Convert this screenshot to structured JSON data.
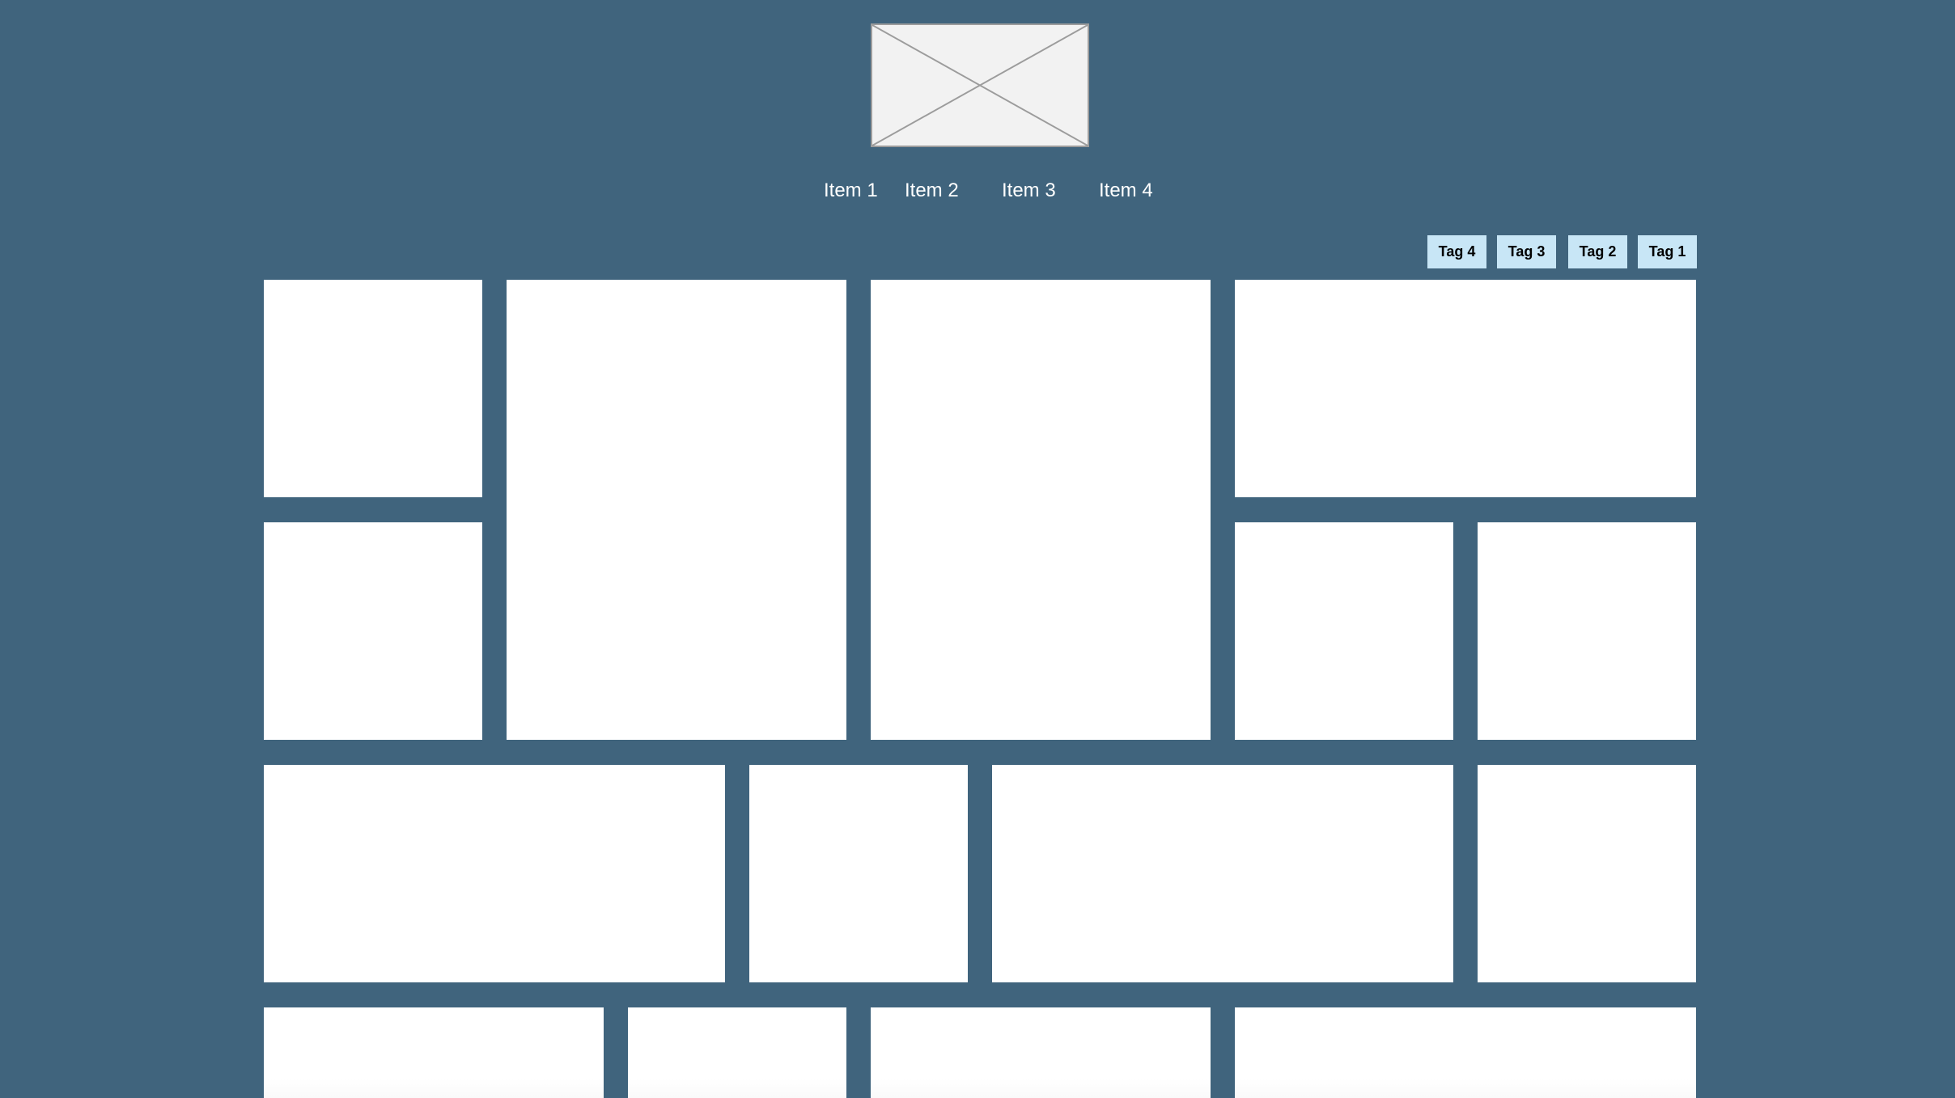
{
  "logo": {
    "alt": "Image placeholder",
    "icon": "image-placeholder-icon"
  },
  "nav": {
    "items": [
      {
        "label": "Item 1"
      },
      {
        "label": "Item 2"
      },
      {
        "label": "Item 3"
      },
      {
        "label": "Item 4"
      }
    ]
  },
  "tags": [
    {
      "label": "Tag 4"
    },
    {
      "label": "Tag 3"
    },
    {
      "label": "Tag 2"
    },
    {
      "label": "Tag 1"
    }
  ],
  "colors": {
    "background": "#40647d",
    "tag_background": "#c8e6f6",
    "tile": "#ffffff",
    "placeholder_fill": "#f2f2f2",
    "placeholder_stroke": "#9c9c9c"
  }
}
